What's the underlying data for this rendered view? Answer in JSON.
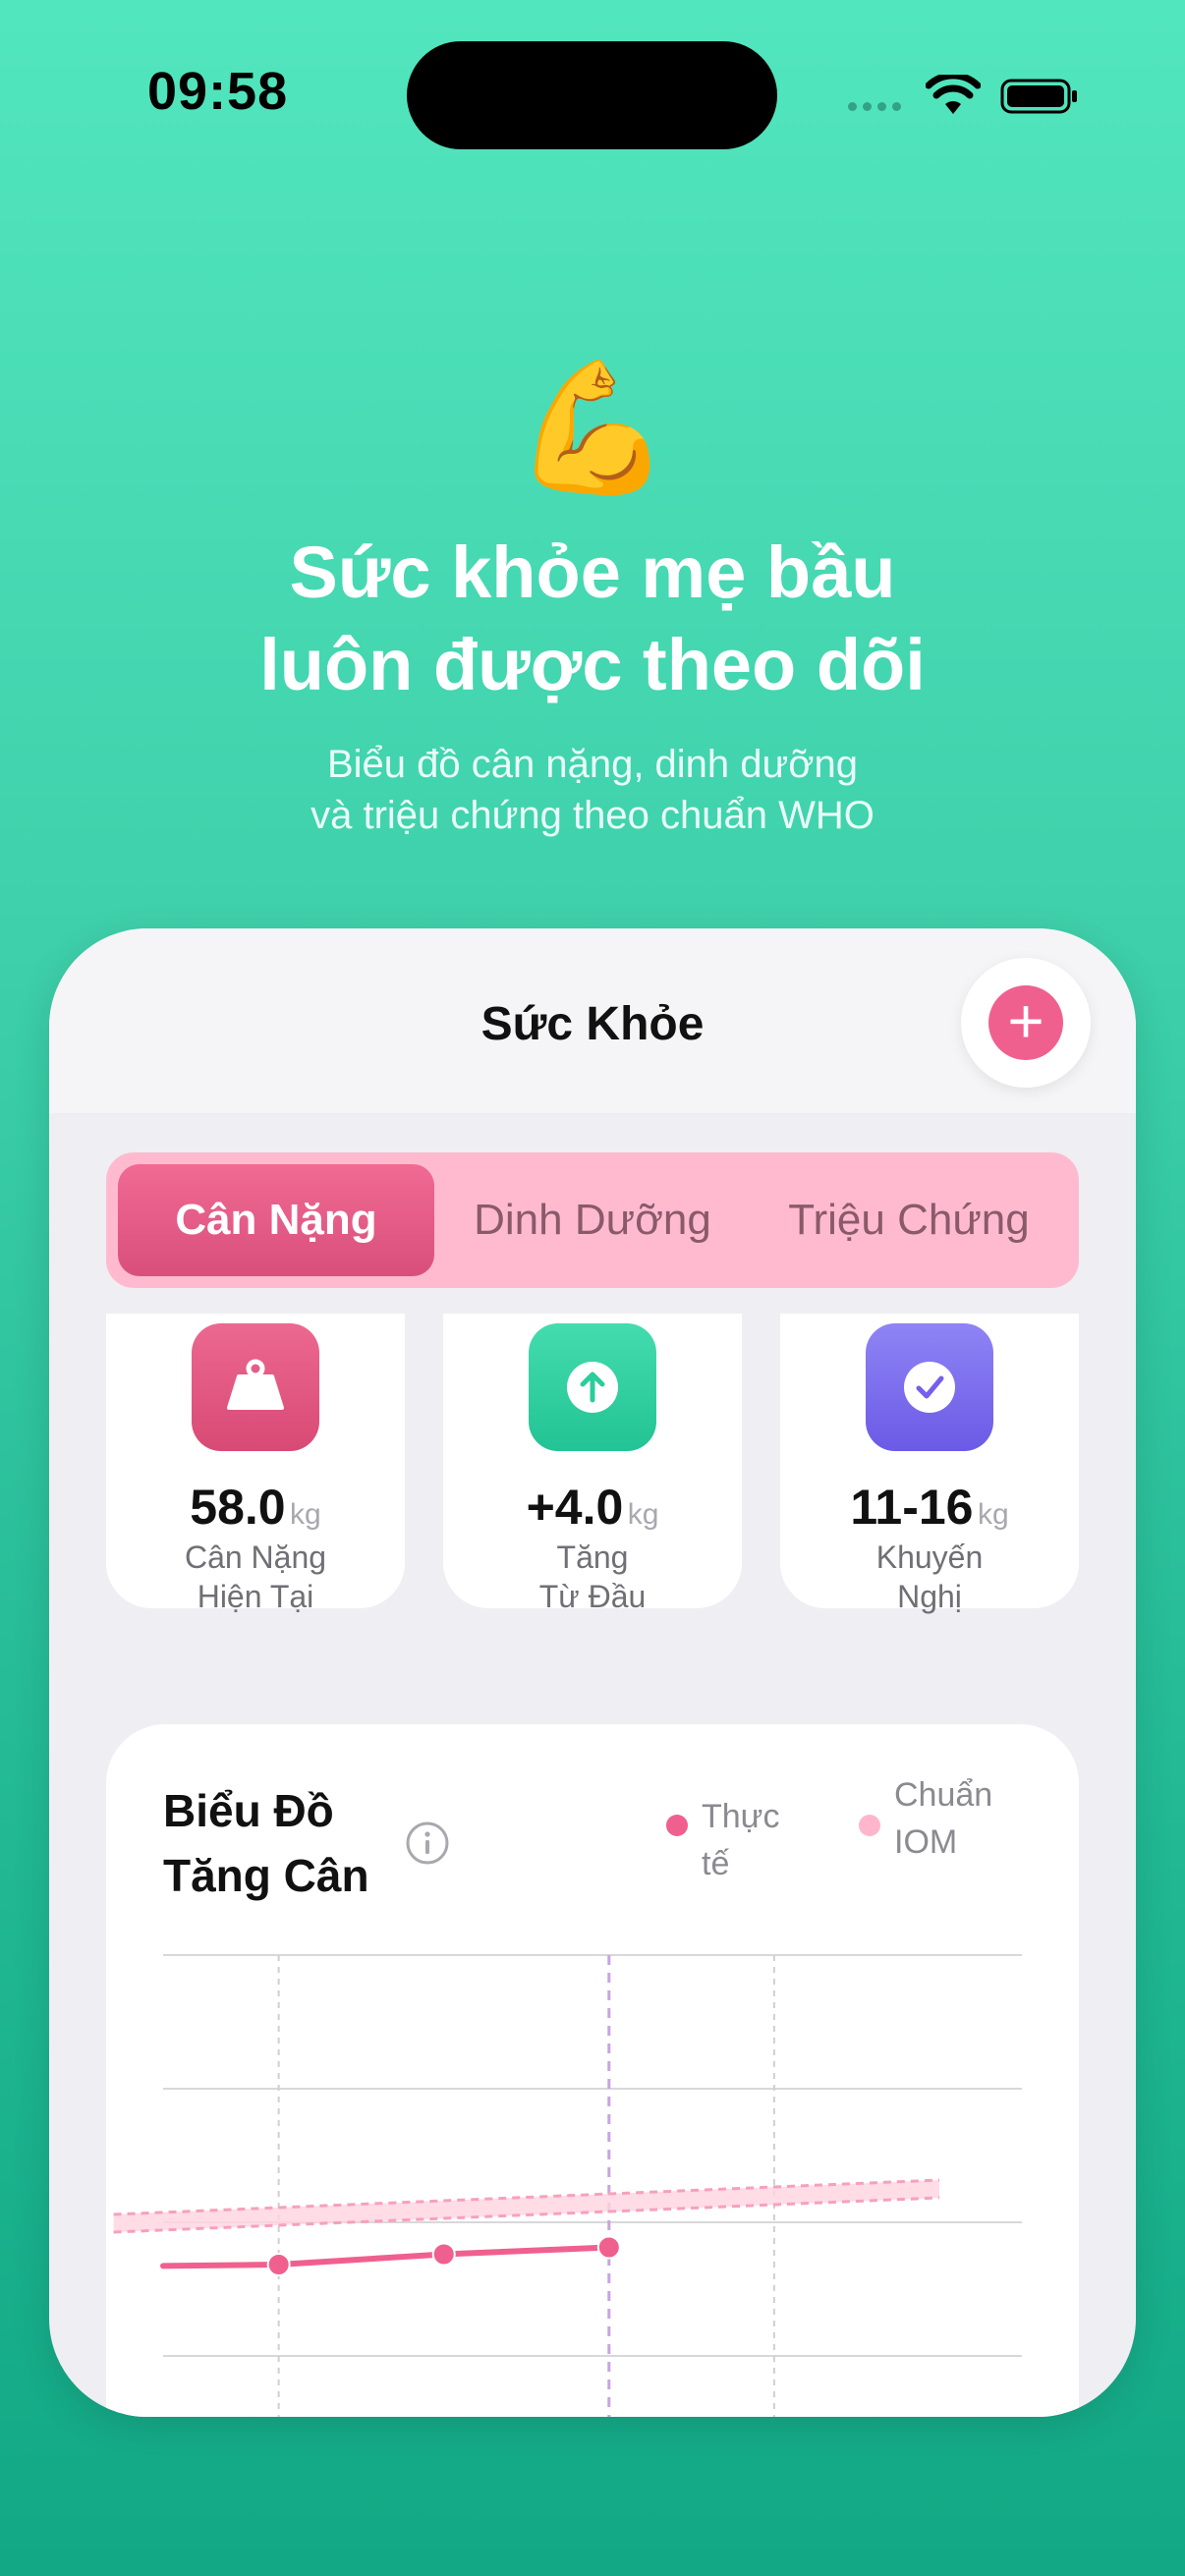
{
  "status_bar": {
    "time": "09:58"
  },
  "hero": {
    "emoji": "💪",
    "title_line1": "Sức khỏe mẹ bầu",
    "title_line2": "luôn được theo dõi",
    "subtitle_line1": "Biểu đồ cân nặng, dinh dưỡng",
    "subtitle_line2": "và triệu chứng theo chuẩn WHO"
  },
  "app": {
    "title": "Sức Khỏe",
    "add_icon": "+",
    "tabs": [
      {
        "label": "Cân Nặng",
        "active": true
      },
      {
        "label": "Dinh Dưỡng",
        "active": false
      },
      {
        "label": "Triệu Chứng",
        "active": false
      }
    ],
    "stats": [
      {
        "icon": "weight-icon",
        "value": "58.0",
        "unit": "kg",
        "label_line1": "Cân Nặng",
        "label_line2": "Hiện Tại",
        "color": "#e0507a"
      },
      {
        "icon": "arrow-up-icon",
        "value": "+4.0",
        "unit": "kg",
        "label_line1": "Tăng",
        "label_line2": "Từ Đầu",
        "color": "#2ccc9c"
      },
      {
        "icon": "checkmark-icon",
        "value": "11-16",
        "unit": "kg",
        "label_line1": "Khuyến",
        "label_line2": "Nghị",
        "color": "#7e6ef0"
      }
    ],
    "chart_card": {
      "title_line1": "Biểu Đồ",
      "title_line2": "Tăng Cân",
      "legend": [
        {
          "label_line1": "Thực tế",
          "label_line2": "",
          "color": "#f0608f"
        },
        {
          "label_line1": "Chuẩn",
          "label_line2": "IOM",
          "color": "#ffb6cc"
        }
      ]
    }
  },
  "chart_data": {
    "type": "line",
    "series": [
      {
        "name": "Thực tế",
        "points": [
          [
            1,
            0.0
          ],
          [
            2,
            0.15
          ],
          [
            3,
            0.25
          ]
        ]
      },
      {
        "name": "Chuẩn IOM",
        "points": [
          [
            0,
            0.6
          ],
          [
            5,
            1.1
          ]
        ]
      }
    ],
    "xlim": [
      0.3,
      5.5
    ],
    "ylim": [
      -3,
      4.5
    ],
    "grid": true,
    "current_marker_x": 3
  }
}
